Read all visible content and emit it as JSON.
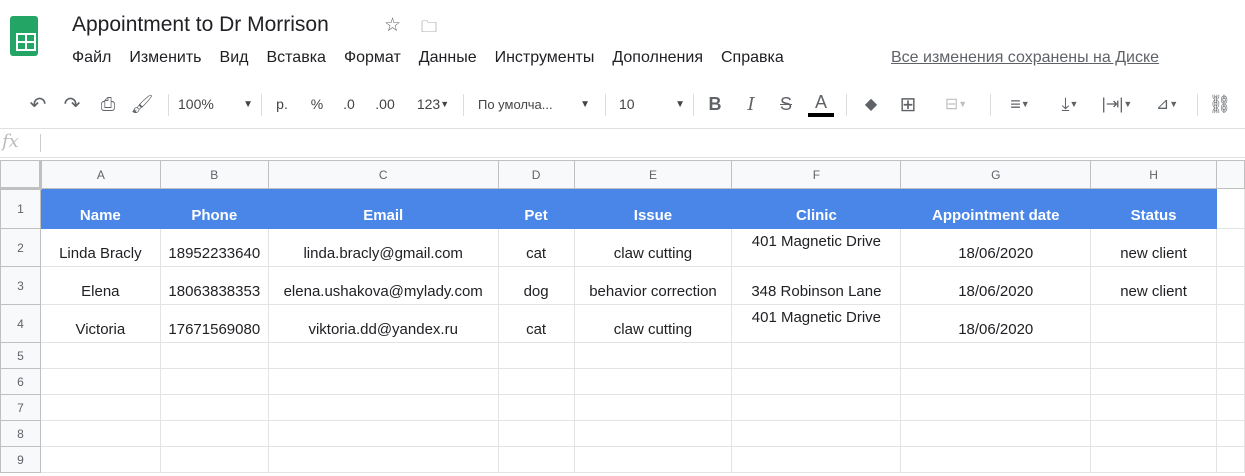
{
  "title": "Appointment to Dr Morrison",
  "menu": [
    "Файл",
    "Изменить",
    "Вид",
    "Вставка",
    "Формат",
    "Данные",
    "Инструменты",
    "Дополнения",
    "Справка"
  ],
  "saved_status": "Все изменения сохранены на Диске",
  "toolbar": {
    "zoom": "100%",
    "currency": "р.",
    "percent": "%",
    "dec_less": ".0",
    "dec_more": ".00",
    "format": "123",
    "font": "По умолча...",
    "size": "10"
  },
  "formula_label": "fx",
  "columns": [
    "A",
    "B",
    "C",
    "D",
    "E",
    "F",
    "G",
    "H"
  ],
  "rows": [
    {
      "n": "1",
      "cells": [
        "Name",
        "Phone",
        "Email",
        "Pet",
        "Issue",
        "Clinic",
        "Appointment date",
        "Status"
      ]
    },
    {
      "n": "2",
      "cells": [
        "Linda Bracly",
        "18952233640",
        "linda.bracly@gmail.com",
        "cat",
        "claw cutting",
        "401 Magnetic Drive",
        "18/06/2020",
        "new client"
      ]
    },
    {
      "n": "3",
      "cells": [
        "Elena",
        "18063838353",
        "elena.ushakova@mylady.com",
        "dog",
        "behavior correction",
        "348 Robinson Lane",
        "18/06/2020",
        "new client"
      ]
    },
    {
      "n": "4",
      "cells": [
        "Victoria",
        "17671569080",
        "viktoria.dd@yandex.ru",
        "cat",
        "claw cutting",
        "401 Magnetic Drive",
        "18/06/2020",
        ""
      ]
    },
    {
      "n": "5",
      "cells": [
        "",
        "",
        "",
        "",
        "",
        "",
        "",
        ""
      ]
    },
    {
      "n": "6",
      "cells": [
        "",
        "",
        "",
        "",
        "",
        "",
        "",
        ""
      ]
    },
    {
      "n": "7",
      "cells": [
        "",
        "",
        "",
        "",
        "",
        "",
        "",
        ""
      ]
    },
    {
      "n": "8",
      "cells": [
        "",
        "",
        "",
        "",
        "",
        "",
        "",
        ""
      ]
    },
    {
      "n": "9",
      "cells": [
        "",
        "",
        "",
        "",
        "",
        "",
        "",
        ""
      ]
    }
  ],
  "colors": {
    "header_fill": "#4a86e8"
  }
}
